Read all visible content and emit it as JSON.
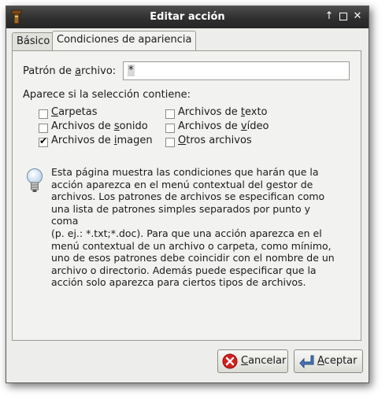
{
  "window": {
    "title": "Editar acción"
  },
  "tabs": [
    {
      "label": "Básico",
      "active": false
    },
    {
      "label": "Condiciones de apariencia",
      "active": true
    }
  ],
  "pattern": {
    "label_prefix": "Patrón de ",
    "label_mnemonic": "a",
    "label_suffix": "rchivo:",
    "value": "*"
  },
  "selection": {
    "heading": "Aparece si la selección contiene:",
    "options": [
      {
        "pre": "",
        "mn": "C",
        "post": "arpetas",
        "checked": false
      },
      {
        "pre": "Archivos de ",
        "mn": "t",
        "post": "exto",
        "checked": false
      },
      {
        "pre": "Archivos de ",
        "mn": "s",
        "post": "onido",
        "checked": false
      },
      {
        "pre": "Archivos de ",
        "mn": "v",
        "post": "ídeo",
        "checked": false
      },
      {
        "pre": "Archivos de ",
        "mn": "i",
        "post": "magen",
        "checked": true
      },
      {
        "pre": "",
        "mn": "O",
        "post": "tros archivos",
        "checked": false
      }
    ]
  },
  "info": {
    "lines": [
      "Esta página muestra las condiciones que harán que la",
      "acción aparezca en el menú contextual del gestor de",
      "archivos. Los patrones de archivos se especifican como",
      "una lista de patrones simples separados por punto y coma",
      "(p. ej.: *.txt;*.doc). Para que una acción aparezca en el",
      "menú contextual de un archivo o carpeta, como mínimo,",
      "uno de esos patrones debe coincidir con el nombre de un",
      "archivo o directorio. Además puede especificar que la",
      "acción solo aparezca para ciertos tipos de archivos."
    ]
  },
  "buttons": {
    "cancel": {
      "mn": "C",
      "post": "ancelar"
    },
    "accept": {
      "mn": "A",
      "post": "ceptar"
    }
  },
  "colors": {
    "titlebar": "#2f2f2f",
    "cancel_icon": "#d42020",
    "accept_icon": "#4a78b8"
  }
}
